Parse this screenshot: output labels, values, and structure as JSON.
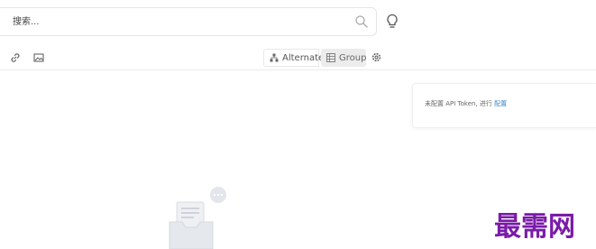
{
  "search": {
    "placeholder": "搜索..."
  },
  "toolbar": {
    "alternate_label": "Alternate",
    "group_label": "Group"
  },
  "notice": {
    "text": "未配置 API Token, 进行 ",
    "link": "配置"
  },
  "watermark": {
    "text": "最需网"
  },
  "icons": {
    "search": "search-icon",
    "hint": "lightbulb-icon",
    "link": "link-icon",
    "image": "image-icon",
    "alternate": "sitemap-icon",
    "group": "grid-icon",
    "settings": "gear-icon",
    "empty": "empty-inbox-illustration"
  },
  "colors": {
    "link": "#3b82c4",
    "watermark": "#7a1ba8",
    "border": "#e6e6e6",
    "segment_active_bg": "#ececec"
  }
}
